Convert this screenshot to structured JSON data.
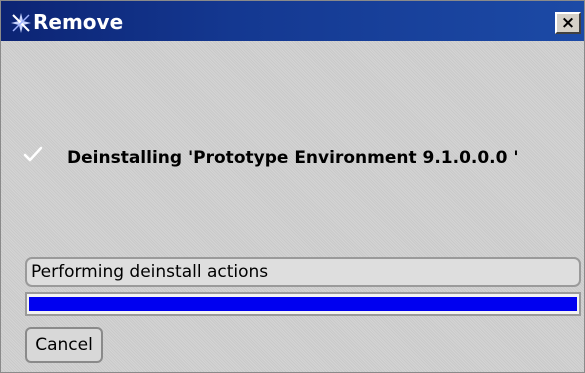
{
  "window": {
    "title": "Remove",
    "close_label": "×",
    "title_icon": "remove-icon",
    "colors": {
      "titlebar": "#143891",
      "background": "#cfcfcf",
      "progress_fill": "#0000f0"
    }
  },
  "main": {
    "status_icon": "check-icon",
    "message": "Deinstalling 'Prototype Environment 9.1.0.0.0 '"
  },
  "status_field": {
    "value": "Performing deinstall actions"
  },
  "progress": {
    "fraction": 1.0
  },
  "buttons": {
    "cancel_label": "Cancel"
  }
}
